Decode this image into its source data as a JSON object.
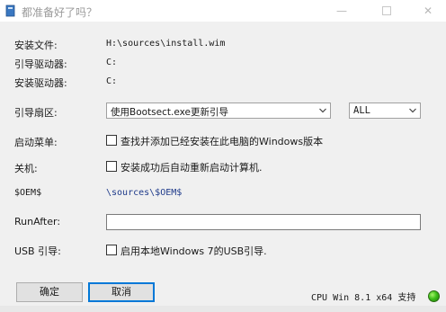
{
  "window": {
    "title": "都准备好了吗？"
  },
  "form": {
    "install_file_label": "安装文件:",
    "install_file_value": "H:\\sources\\install.wim",
    "boot_drive_label": "引导驱动器:",
    "boot_drive_value": "C:",
    "install_drive_label": "安装驱动器:",
    "install_drive_value": "C:",
    "boot_sector_label": "引导扇区:",
    "boot_sector_value": "使用Bootsect.exe更新引导",
    "boot_target_value": "ALL",
    "boot_menu_label": "启动菜单:",
    "boot_menu_checkbox": "查找并添加已经安装在此电脑的Windows版本",
    "shutdown_label": "关机:",
    "shutdown_checkbox": "安装成功后自动重新启动计算机.",
    "oem_label": "$OEM$",
    "oem_value": "\\sources\\$OEM$",
    "runafter_label": "RunAfter:",
    "runafter_value": "",
    "usb_boot_label": "USB 引导:",
    "usb_boot_checkbox": "启用本地Windows 7的USB引导."
  },
  "buttons": {
    "ok": "确定",
    "cancel": "取消"
  },
  "status": {
    "cpu_support": "CPU Win 8.1 x64 支持",
    "light_color": "#3fbf1a"
  }
}
